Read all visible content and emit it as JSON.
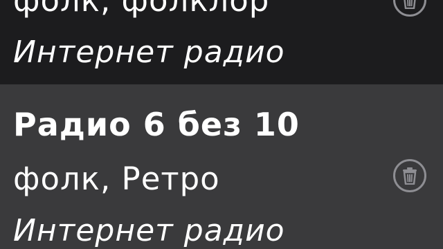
{
  "stations": [
    {
      "title": "",
      "genre": "фолк, фолклор",
      "type": "Интернет радио",
      "delete_icon": "trash-icon"
    },
    {
      "title": "Радио 6 без 10",
      "genre": "фолк, Ретро",
      "type": "Интернет радио",
      "delete_icon": "trash-icon"
    }
  ],
  "colors": {
    "background": "#1c1c1e",
    "selected_row": "#3a3a3c",
    "text": "#ffffff",
    "icon": "#8e8e93"
  }
}
